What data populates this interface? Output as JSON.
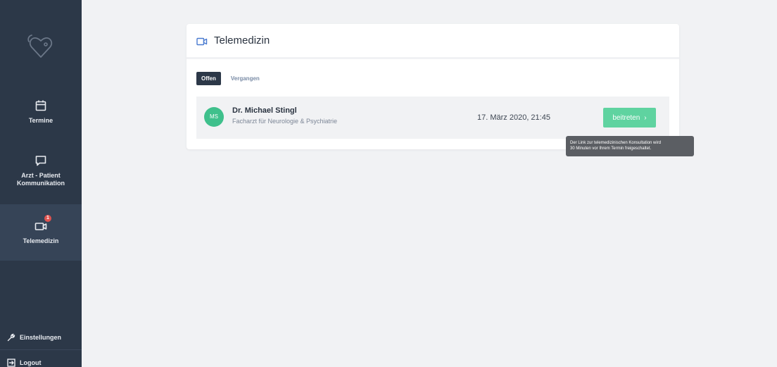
{
  "sidebar": {
    "items": [
      {
        "label": "Termine",
        "icon": "calendar-icon"
      },
      {
        "label": "Arzt - Patient\nKommunikation",
        "icon": "chat-icon"
      },
      {
        "label": "Telemedizin",
        "icon": "video-camera-icon",
        "badge": "1",
        "active": true
      }
    ],
    "settings_label": "Einstellungen",
    "logout_label": "Logout"
  },
  "card": {
    "title": "Telemedizin",
    "tabs": [
      {
        "label": "Offen",
        "active": true
      },
      {
        "label": "Vergangen",
        "active": false
      }
    ],
    "appointment": {
      "initials": "MS",
      "doctor_name": "Dr. Michael Stingl",
      "specialty": "Facharzt für Neurologie & Psychiatrie",
      "datetime": "17. März 2020, 21:45",
      "join_label": "beitreten",
      "join_chevron": "›"
    }
  },
  "tooltip": {
    "line1": "Der Link zur telemedizinischen Konsultation wird",
    "line2": "30 Minuten vor Ihrem Termin freigeschaltet."
  },
  "colors": {
    "sidebar_bg": "#2c3848",
    "accent_green": "#5fd3a0",
    "avatar_green": "#3fc08c",
    "badge_red": "#e0534f",
    "page_bg": "#f1f2f4"
  }
}
